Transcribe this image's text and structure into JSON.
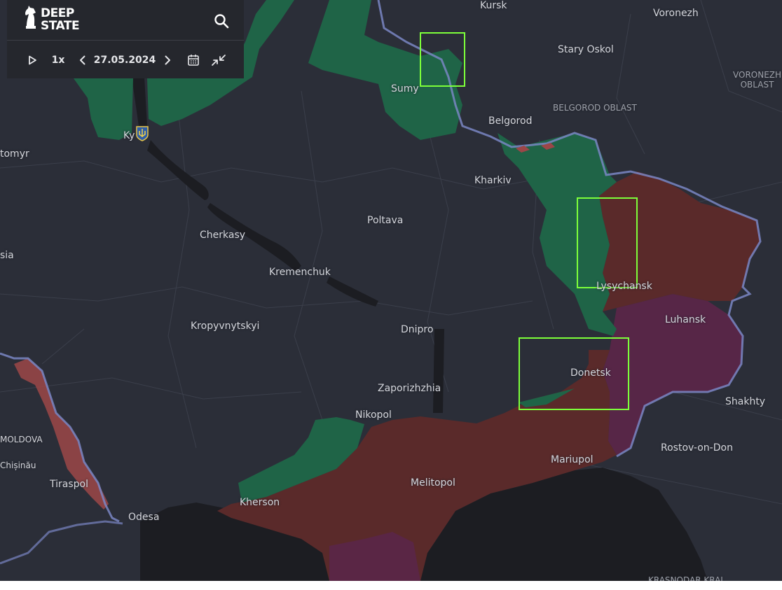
{
  "app": {
    "logo_line1": "DEEP",
    "logo_line2": "STATE"
  },
  "timeline": {
    "speed": "1x",
    "date": "27.05.2024"
  },
  "controls": {
    "icons": [
      "search-icon",
      "play-icon",
      "chevron-left-icon",
      "chevron-right-icon",
      "calendar-icon",
      "collapse-icon"
    ]
  },
  "map": {
    "colors": {
      "background": "#2b2e38",
      "sea": "#1c1d22",
      "occupied": "#5a2a2a",
      "occupied_before_2022": "#5a2648",
      "liberated": "#1f6447",
      "transnistria": "#9c4648",
      "border": "#7a86c4",
      "highlight": "#7dff3a"
    },
    "cities": {
      "kursk": "Kursk",
      "voronezh": "Voronezh",
      "stary_oskol": "Stary Oskol",
      "sumy": "Sumy",
      "belgorod": "Belgorod",
      "kyiv": "Ky",
      "zhytomyr": "tomyr",
      "kharkiv": "Kharkiv",
      "poltava": "Poltava",
      "cherkasy": "Cherkasy",
      "vinnytsia": "sia",
      "kremenchuk": "Kremenchuk",
      "lysychansk": "Lysychansk",
      "luhansk": "Luhansk",
      "kropyvnytskyi": "Kropyvnytskyi",
      "dnipro": "Dnipro",
      "donetsk": "Donetsk",
      "zaporizhzhia": "Zaporizhzhia",
      "shakhty": "Shakhty",
      "nikopol": "Nikopol",
      "moldova": "MOLDOVA",
      "chisinau": "Chișinău",
      "rostov": "Rostov-on-Don",
      "mariupol": "Mariupol",
      "tiraspol": "Tiraspol",
      "melitopol": "Melitopol",
      "kherson": "Kherson",
      "odesa": "Odesa"
    },
    "regions": {
      "voronezh_oblast_1": "VORONEZH",
      "voronezh_oblast_2": "OBLAST",
      "belgorod_oblast": "BELGOROD OBLAST",
      "krasnodar_krai": "KRASNODAR KRAI"
    }
  }
}
